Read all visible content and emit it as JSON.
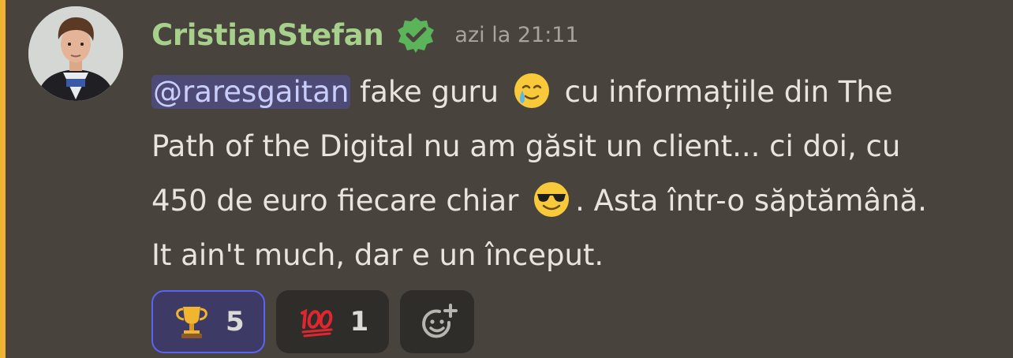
{
  "message": {
    "username": "CristianStefan",
    "timestamp": "azi la 21:11",
    "mention": "@raresgaitan",
    "line1_text": " fake guru ",
    "line1_after_emoji": " cu informațiile din The",
    "line2": "Path of the Digital nu am găsit un client... ci doi, cu",
    "line3_before_emoji": "450 de euro fiecare chiar ",
    "line3_after_emoji": ". Asta într-o săptămână.",
    "line4": "It ain't much, dar e un început.",
    "emojis": [
      "smiling-face-with-tear",
      "smiling-face-with-sunglasses"
    ]
  },
  "reactions": [
    {
      "icon": "trophy-icon",
      "count": "5",
      "selected": true
    },
    {
      "icon": "hundred-points-icon",
      "count": "1",
      "selected": false
    }
  ],
  "colors": {
    "background": "#48443d",
    "username": "#a8d08d",
    "mention_bg": "#4d4a76",
    "accent_bar": "#f0b232",
    "selected_reaction_border": "#5865f2"
  }
}
